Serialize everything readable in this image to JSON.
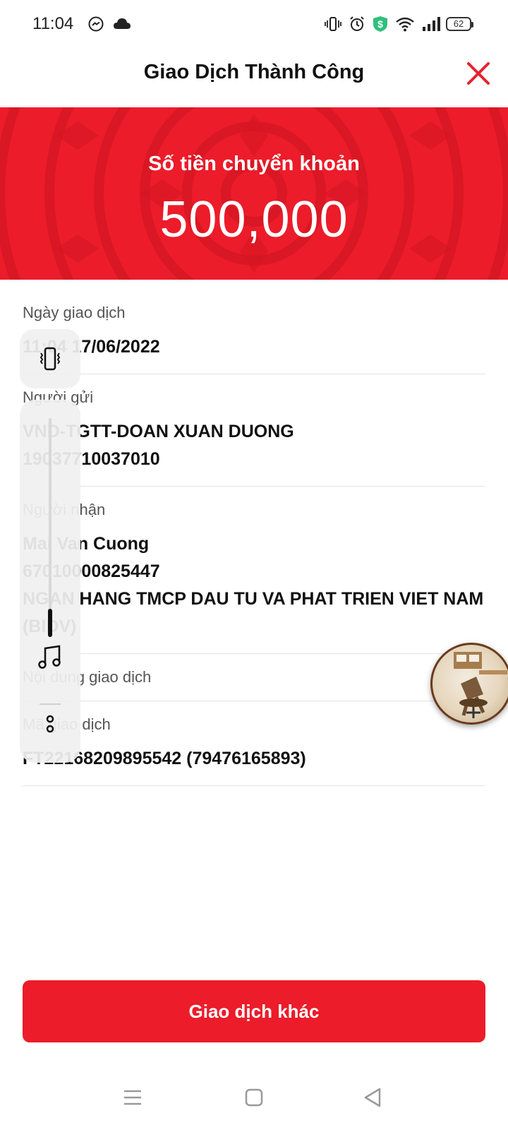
{
  "status_bar": {
    "time": "11:04",
    "battery": "62",
    "left_icons": [
      "messenger-icon",
      "cloud-icon"
    ],
    "right_icons": [
      "vibrate-icon",
      "alarm-icon",
      "shield-dollar-icon",
      "wifi-icon",
      "signal-icon"
    ]
  },
  "header": {
    "title": "Giao Dịch Thành Công",
    "close_icon": "close-icon"
  },
  "banner": {
    "label": "Số tiền chuyển khoản",
    "amount": "500,000"
  },
  "details": [
    {
      "label": "Ngày giao dịch",
      "lines": [
        "11:04 17/06/2022"
      ]
    },
    {
      "label": "Người gửi",
      "lines": [
        "VND-TGTT-DOAN XUAN DUONG",
        "19037710037010"
      ]
    },
    {
      "label": "Người nhận",
      "lines": [
        "Mai Van Cuong",
        "67010000825447",
        "NGAN HANG TMCP DAU TU VA PHAT TRIEN VIET NAM (BIDV)"
      ]
    },
    {
      "label": "Nội dung giao dịch",
      "lines": []
    },
    {
      "label": "Mã giao dịch",
      "lines": [
        "FT22168209895542 (79476165893)"
      ]
    }
  ],
  "volume_panel": {
    "icons": [
      "vibrate-icon",
      "music-note-icon",
      "more-options-icon"
    ],
    "level": 0.07
  },
  "actions": {
    "other_transaction": "Giao dịch khác"
  },
  "colors": {
    "brand_red": "#ec1c2a"
  },
  "nav_bar": {
    "icons": [
      "menu-icon",
      "home-icon",
      "back-icon"
    ]
  }
}
